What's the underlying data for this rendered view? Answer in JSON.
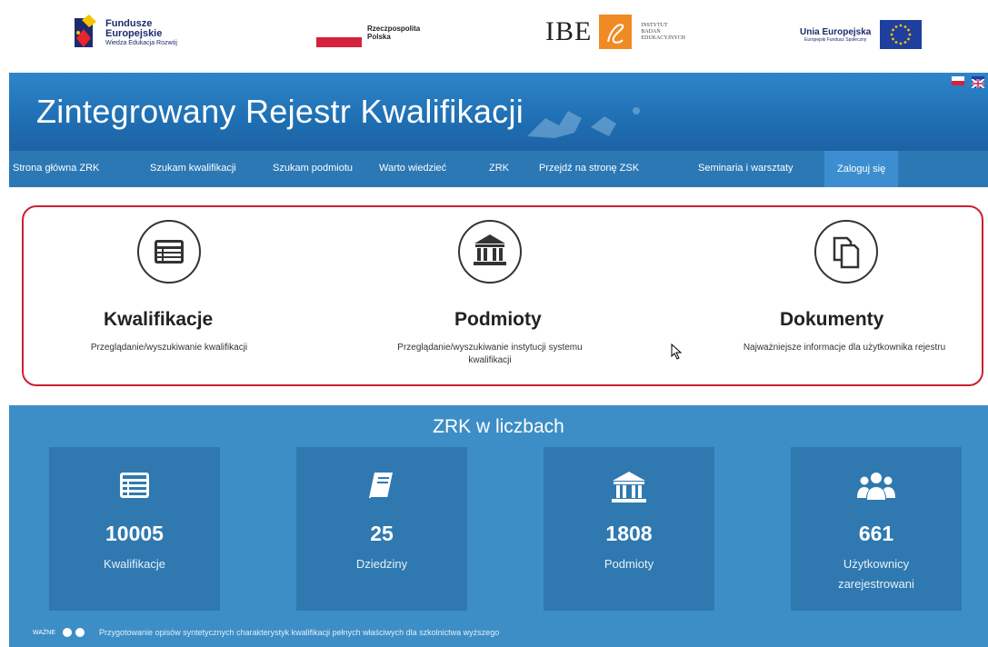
{
  "logos": {
    "fe_line1": "Fundusze",
    "fe_line2": "Europejskie",
    "fe_sub": "Wiedza Edukacja Rozwój",
    "rp_line1": "Rzeczpospolita",
    "rp_line2": "Polska",
    "ibe": "IBE",
    "ibe_inst1": "INSTYTUT",
    "ibe_inst2": "BADAŃ",
    "ibe_inst3": "EDUKACYJNYCH",
    "ue_line1": "Unia Europejska",
    "ue_line2": "Europejski Fundusz Społeczny"
  },
  "hero": {
    "title": "Zintegrowany Rejestr Kwalifikacji"
  },
  "nav": {
    "items": [
      "Strona główna ZRK",
      "Szukam kwalifikacji",
      "Szukam podmiotu",
      "Warto wiedzieć",
      "ZRK",
      "Przejdź na stronę ZSK",
      "Seminaria i warsztaty",
      "Zaloguj się"
    ]
  },
  "features": [
    {
      "icon": "list-icon",
      "title": "Kwalifikacje",
      "desc": "Przeglądanie/wyszukiwanie kwalifikacji"
    },
    {
      "icon": "institution-icon",
      "title": "Podmioty",
      "desc": "Przeglądanie/wyszukiwanie instytucji systemu kwalifikacji"
    },
    {
      "icon": "documents-icon",
      "title": "Dokumenty",
      "desc": "Najważniejsze informacje dla użytkownika rejestru"
    }
  ],
  "stats": {
    "title": "ZRK w liczbach",
    "items": [
      {
        "icon": "list-icon",
        "value": "10005",
        "label": "Kwalifikacje"
      },
      {
        "icon": "book-icon",
        "value": "25",
        "label": "Dziedziny"
      },
      {
        "icon": "institution-icon",
        "value": "1808",
        "label": "Podmioty"
      },
      {
        "icon": "users-icon",
        "value": "661",
        "label": "Użytkownicy zarejestrowani"
      }
    ]
  },
  "ticker": {
    "badge": "WAŻNE",
    "text": "Przygotowanie opisów syntetycznych charakterystyk kwalifikacji pełnych właściwych dla szkolnictwa wyższego"
  },
  "colors": {
    "hero": "#2e86c8",
    "nav": "#2b78b5",
    "stats_bg": "#3d8ec6",
    "stat_card": "#2f79b0",
    "highlight": "#cc1f2f"
  }
}
